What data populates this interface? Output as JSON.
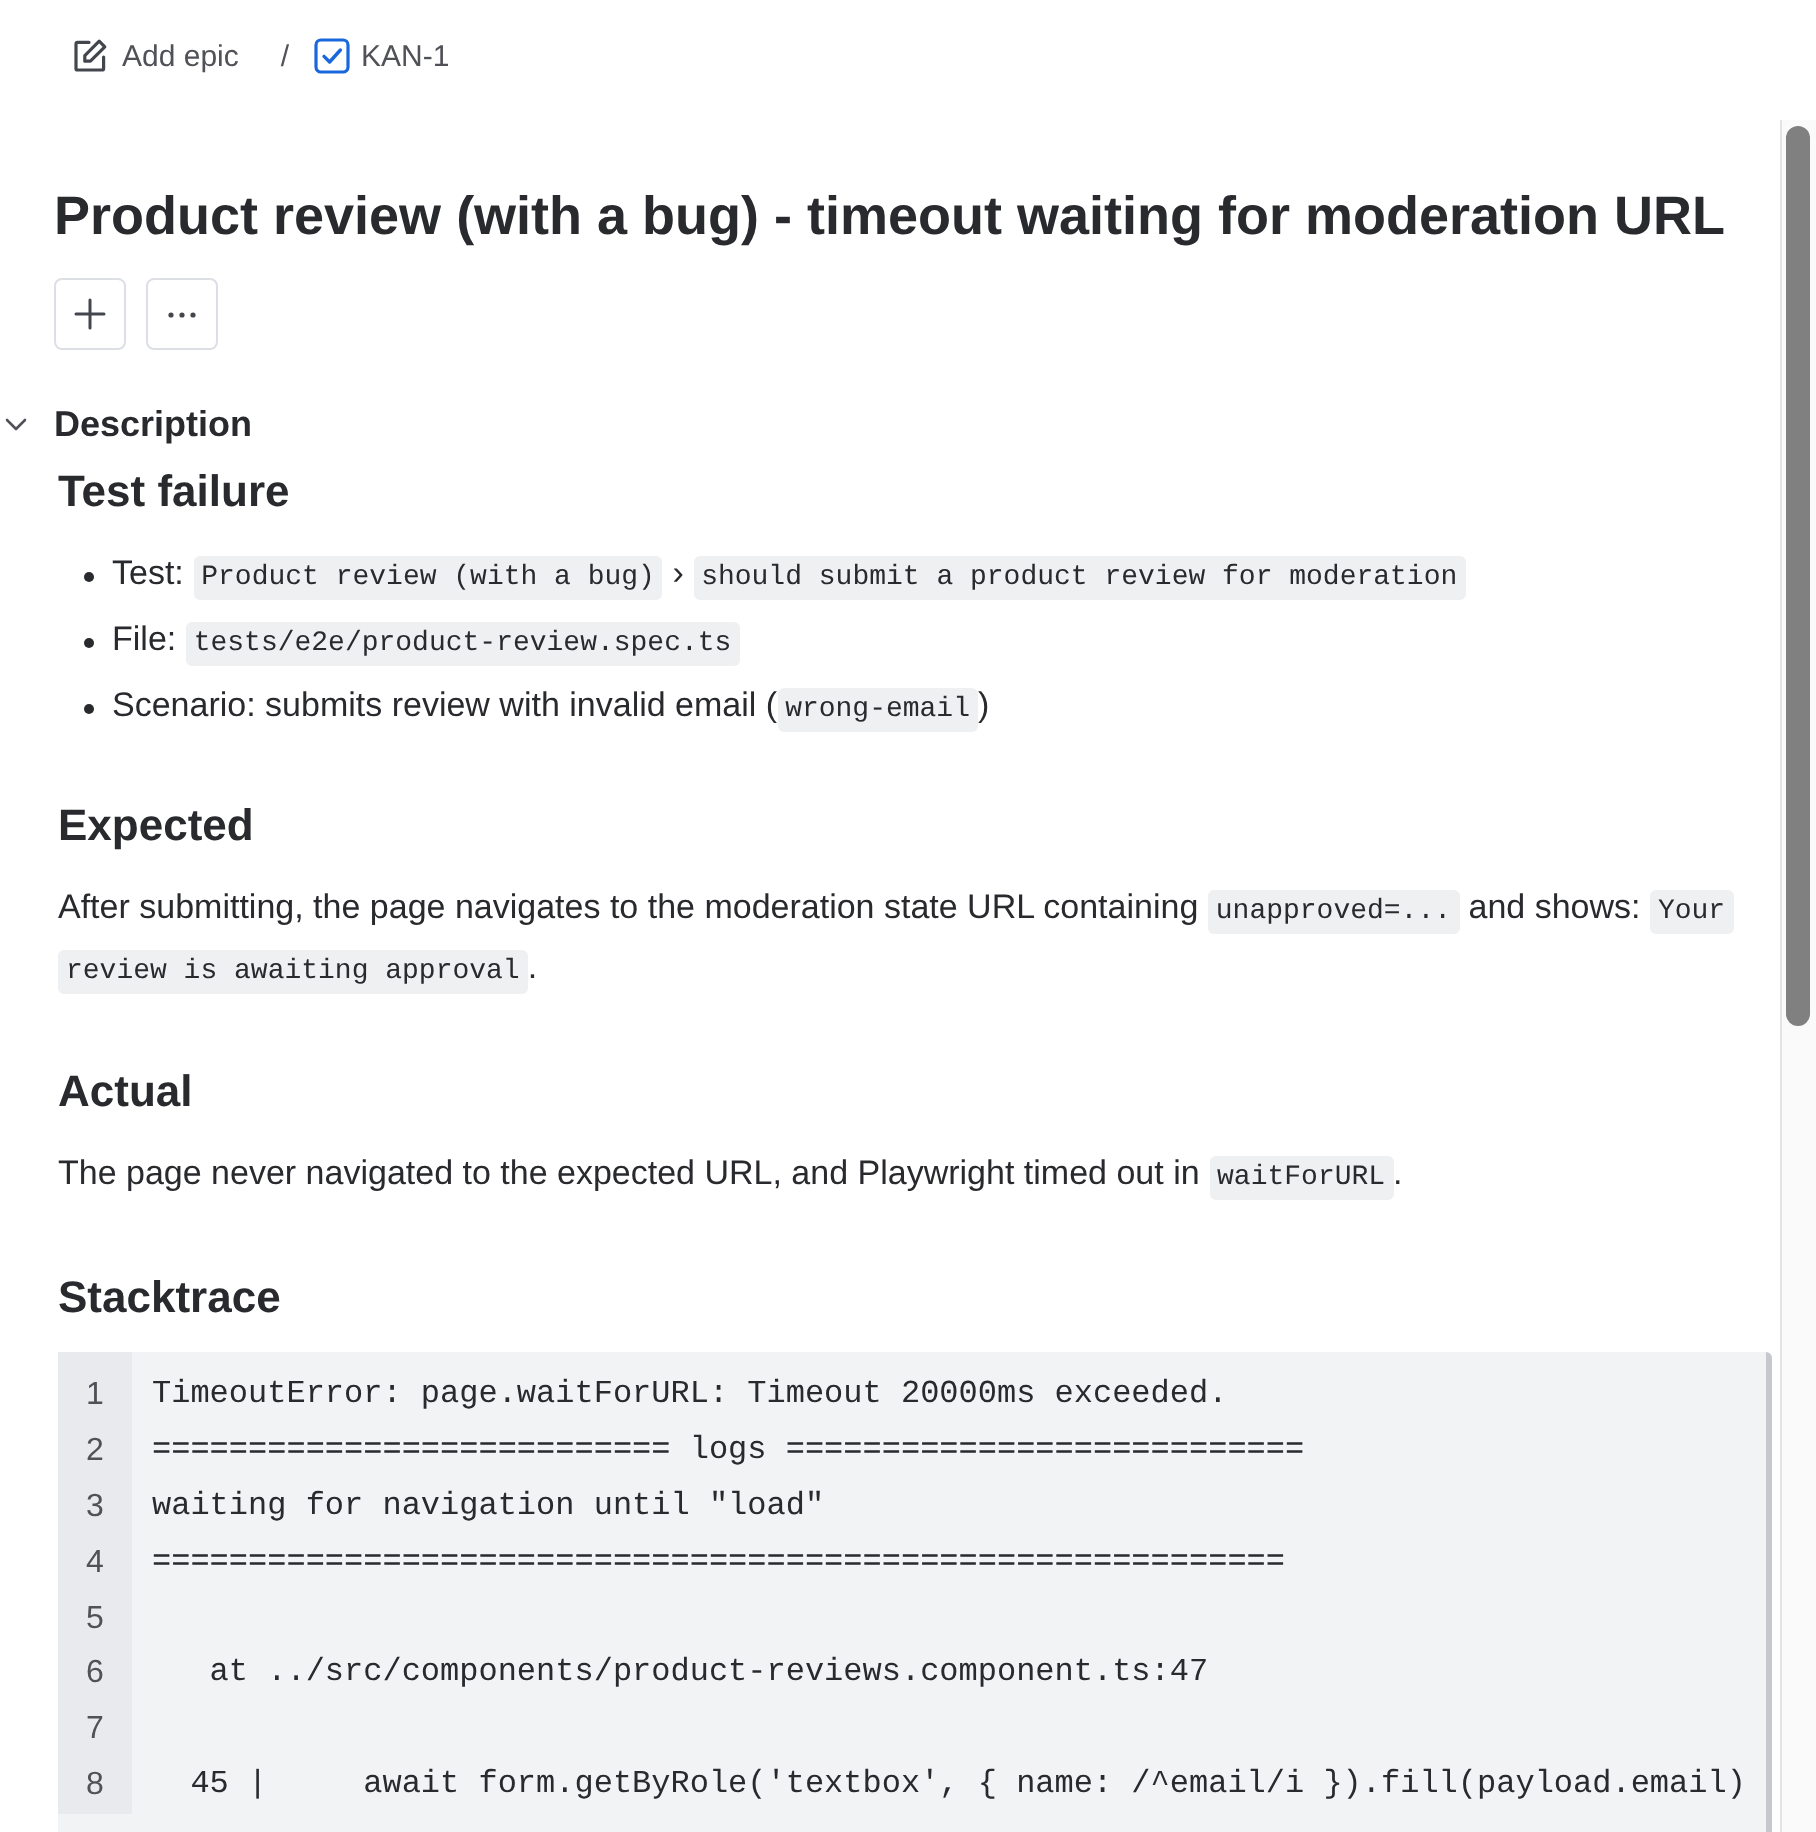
{
  "breadcrumb": {
    "parent": {
      "label": "Add epic"
    },
    "separator": "/",
    "issue": {
      "key": "KAN-1"
    }
  },
  "issue": {
    "title": "Product review (with a bug) - timeout waiting for moderation URL"
  },
  "description": {
    "label": "Description",
    "expanded": true,
    "blocks": [
      {
        "kind": "heading",
        "text": "Test failure"
      },
      {
        "kind": "bullets",
        "items": [
          {
            "parts": [
              {
                "kind": "text",
                "text": "Test: "
              },
              {
                "kind": "code",
                "text": "Product review (with a bug)"
              },
              {
                "kind": "text",
                "text": " › "
              },
              {
                "kind": "code",
                "text": "should submit a product review for moderation"
              }
            ]
          },
          {
            "parts": [
              {
                "kind": "text",
                "text": "File: "
              },
              {
                "kind": "code",
                "text": "tests/e2e/product-review.spec.ts"
              }
            ]
          },
          {
            "parts": [
              {
                "kind": "text",
                "text": "Scenario: submits review with invalid email ("
              },
              {
                "kind": "code",
                "text": "wrong-email"
              },
              {
                "kind": "text",
                "text": ")"
              }
            ]
          }
        ]
      },
      {
        "kind": "heading",
        "text": "Expected"
      },
      {
        "kind": "paragraph",
        "parts": [
          {
            "kind": "text",
            "text": "After submitting, the page navigates to the moderation state URL containing "
          },
          {
            "kind": "code",
            "text": "unapproved=..."
          },
          {
            "kind": "text",
            "text": " and shows: "
          },
          {
            "kind": "code",
            "text": "Your review is awaiting approval"
          },
          {
            "kind": "text",
            "text": "."
          }
        ]
      },
      {
        "kind": "heading",
        "text": "Actual"
      },
      {
        "kind": "paragraph",
        "parts": [
          {
            "kind": "text",
            "text": "The page never navigated to the expected URL, and Playwright timed out in "
          },
          {
            "kind": "code",
            "text": "waitForURL"
          },
          {
            "kind": "text",
            "text": "."
          }
        ]
      },
      {
        "kind": "heading",
        "text": "Stacktrace"
      },
      {
        "kind": "code_block",
        "lines": [
          {
            "number": "1",
            "text": "TimeoutError: page.waitForURL: Timeout 20000ms exceeded."
          },
          {
            "number": "2",
            "text": "=========================== logs ==========================="
          },
          {
            "number": "3",
            "text": "waiting for navigation until \"load\""
          },
          {
            "number": "4",
            "text": "==========================================================="
          },
          {
            "number": "5"
          },
          {
            "number": "6",
            "text": "   at ../src/components/product-reviews.component.ts:47"
          },
          {
            "number": "7"
          },
          {
            "number": "8",
            "text": "  45 |     await form.getByRole('textbox', { name: /^email/i }).fill(payload.email)"
          }
        ]
      }
    ]
  }
}
